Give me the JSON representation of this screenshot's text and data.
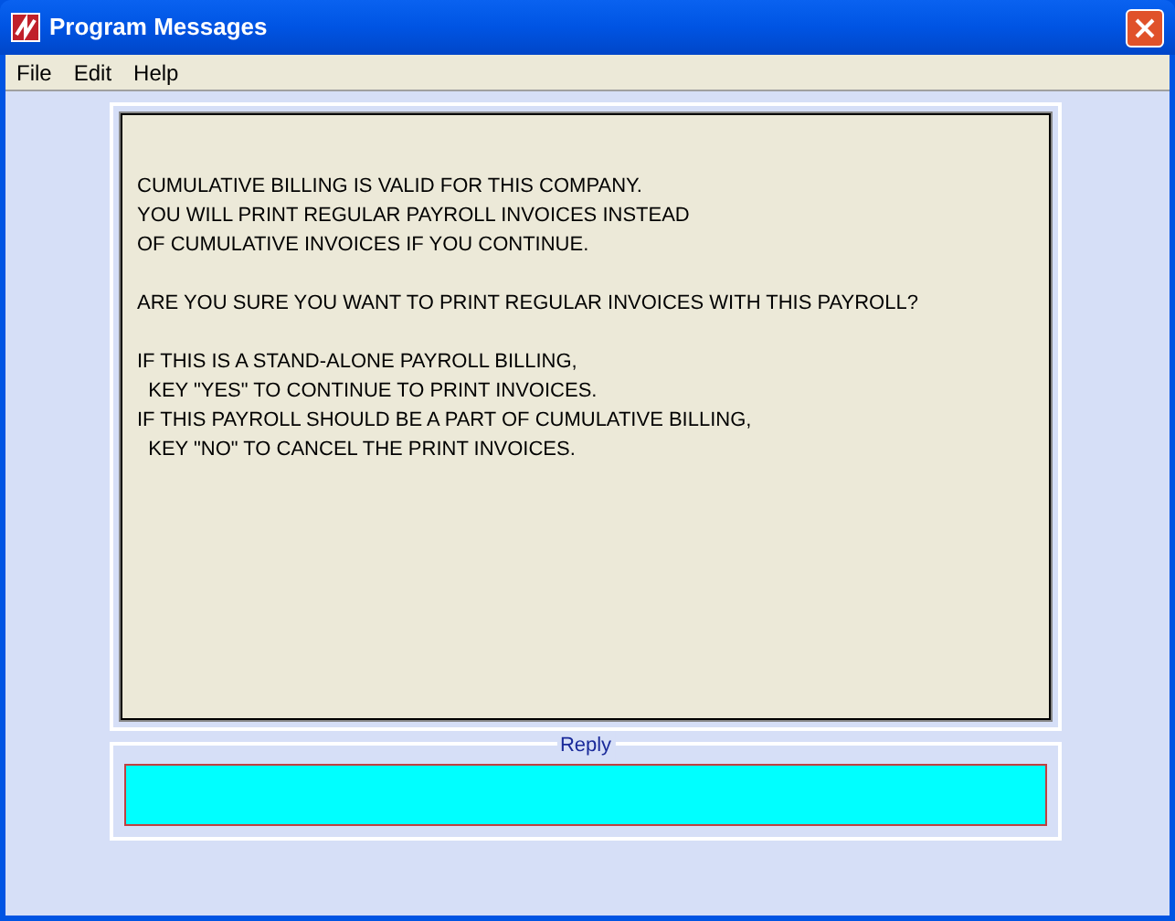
{
  "window": {
    "title": "Program Messages"
  },
  "menu": [
    {
      "label": "File"
    },
    {
      "label": "Edit"
    },
    {
      "label": "Help"
    }
  ],
  "message": [
    [
      "CUMULATIVE BILLING IS VALID FOR THIS COMPANY.",
      "YOU WILL PRINT REGULAR PAYROLL INVOICES INSTEAD",
      "OF CUMULATIVE INVOICES IF YOU CONTINUE."
    ],
    [
      "ARE YOU SURE YOU WANT TO PRINT REGULAR INVOICES WITH THIS PAYROLL?"
    ],
    [
      "IF THIS IS A STAND-ALONE PAYROLL BILLING,",
      "  KEY \"YES\" TO CONTINUE TO PRINT INVOICES.",
      "IF THIS PAYROLL SHOULD BE A PART OF CUMULATIVE BILLING,",
      "  KEY \"NO\" TO CANCEL THE PRINT INVOICES."
    ]
  ],
  "reply": {
    "label": "Reply"
  }
}
